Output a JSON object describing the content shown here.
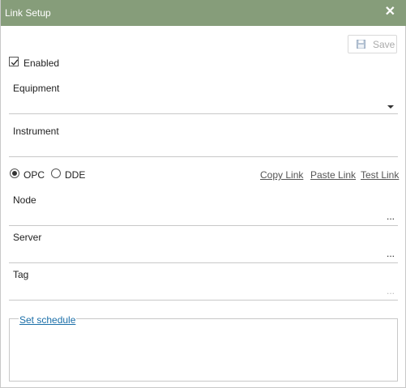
{
  "window": {
    "title": "Link Setup",
    "close_glyph": "✕",
    "accent": "#869d7a"
  },
  "toolbar": {
    "save_label": "Save",
    "save_icon": "floppy-disk-icon",
    "save_enabled": false
  },
  "enabled": {
    "label": "Enabled",
    "checked": true
  },
  "equipment": {
    "label": "Equipment",
    "value": ""
  },
  "instrument": {
    "label": "Instrument",
    "value": ""
  },
  "protocol": {
    "options": [
      {
        "label": "OPC",
        "selected": true
      },
      {
        "label": "DDE",
        "selected": false
      }
    ]
  },
  "link_actions": {
    "copy": "Copy Link",
    "paste": "Paste Link",
    "test": "Test Link"
  },
  "node": {
    "label": "Node",
    "value": "",
    "browse": "..."
  },
  "server": {
    "label": "Server",
    "value": "",
    "browse": "..."
  },
  "tag": {
    "label": "Tag",
    "value": "",
    "browse": "...",
    "browse_enabled": false
  },
  "schedule": {
    "link_label": "Set schedule"
  }
}
